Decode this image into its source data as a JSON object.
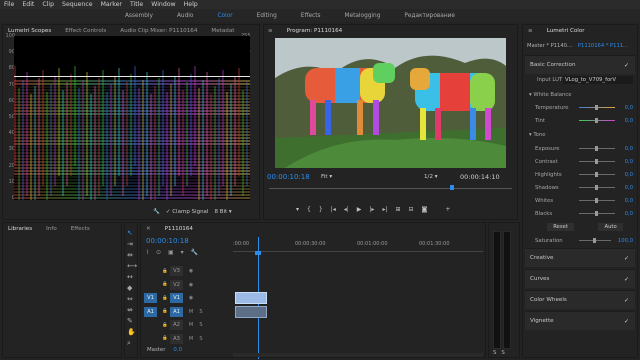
{
  "menu": [
    "File",
    "Edit",
    "Clip",
    "Sequence",
    "Marker",
    "Title",
    "Window",
    "Help"
  ],
  "workspaces": [
    "Assembly",
    "Audio",
    "Color",
    "Editing",
    "Effects",
    "Metalogging",
    "Редактирование"
  ],
  "active_workspace": "Color",
  "scopes_panel": {
    "tabs": [
      "Lumetri Scopes",
      "Effect Controls",
      "Audio Clip Mixer: P1110164",
      "Metadat"
    ],
    "left_ticks": [
      "100",
      "90",
      "80",
      "70",
      "60",
      "50",
      "40",
      "30",
      "20",
      "10",
      "0"
    ],
    "right_ticks": [
      "255",
      "230",
      "204",
      "178",
      "153",
      "128",
      "102",
      "76",
      "51",
      "26",
      "0"
    ],
    "clamp_signal": "Clamp Signal",
    "bit_depth": "8 Bit"
  },
  "program_panel": {
    "title": "Program: P1110164",
    "timecode": "00:00:10:18",
    "fit": "Fit",
    "fraction": "1/2",
    "duration": "00:00:14:10"
  },
  "lumetri_panel": {
    "title": "Lumetri Color",
    "master": "Master * P1140...",
    "clip": "P1110164 * P111...",
    "basic_correction": "Basic Correction",
    "input_lut_label": "Input LUT",
    "input_lut_value": "VLog_to_V709_forV",
    "white_balance": "White Balance",
    "temperature_label": "Temperature",
    "temperature_value": "0,0",
    "tint_label": "Tint",
    "tint_value": "0,0",
    "tone": "Tone",
    "exposure_label": "Exposure",
    "exposure_value": "0,0",
    "contrast_label": "Contrast",
    "contrast_value": "0,0",
    "highlights_label": "Highlights",
    "highlights_value": "0,0",
    "shadows_label": "Shadows",
    "shadows_value": "0,0",
    "whites_label": "Whites",
    "whites_value": "0,0",
    "blacks_label": "Blacks",
    "blacks_value": "0,0",
    "reset": "Reset",
    "auto": "Auto",
    "saturation_label": "Saturation",
    "saturation_value": "100,0",
    "creative": "Creative",
    "curves": "Curves",
    "color_wheels": "Color Wheels",
    "vignette": "Vignette"
  },
  "libraries_panel": {
    "tabs": [
      "Libraries",
      "Info",
      "Effects"
    ]
  },
  "timeline": {
    "seq_name": "P1110164",
    "timecode": "00:00:10:18",
    "ruler": [
      ":00:00",
      "00:00:30:00",
      "00:01:00:00",
      "00:01:30:00"
    ],
    "tracks": [
      {
        "src": "",
        "name": "V3",
        "icons": [
          "lock",
          "eye"
        ]
      },
      {
        "src": "",
        "name": "V2",
        "icons": [
          "lock",
          "eye"
        ]
      },
      {
        "src": "V1",
        "name": "V1",
        "icons": [
          "lock",
          "eye"
        ]
      },
      {
        "src": "A1",
        "name": "A1",
        "icons": [
          "lock",
          "M",
          "S"
        ]
      },
      {
        "src": "",
        "name": "A2",
        "icons": [
          "lock",
          "M",
          "S"
        ]
      },
      {
        "src": "",
        "name": "A3",
        "icons": [
          "lock",
          "M",
          "S"
        ]
      }
    ],
    "master_label": "Master",
    "master_value": "0,0"
  },
  "meters": {
    "labels": [
      "S",
      "S"
    ]
  },
  "colors": {
    "accent": "#2d8ceb",
    "panel": "#232323",
    "timecode": "#2d8ceb"
  }
}
